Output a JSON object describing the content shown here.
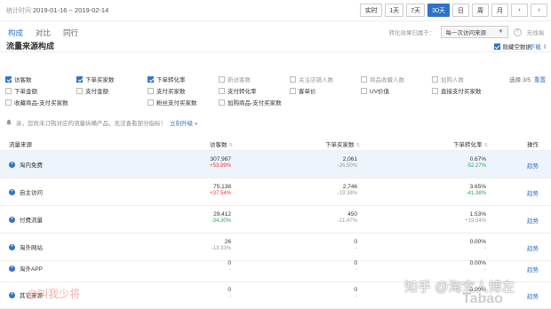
{
  "topbar": {
    "stat_label": "统计时间",
    "date_range": "2019-01-16 ~ 2019-02-14",
    "periods": [
      "实时",
      "1天",
      "7天",
      "30天",
      "日",
      "周",
      "月"
    ],
    "active_period": "30天"
  },
  "tabs": [
    {
      "label": "构成",
      "active": true
    },
    {
      "label": "对比",
      "active": false
    },
    {
      "label": "同行",
      "active": false
    }
  ],
  "attribution": {
    "label": "转化效果归属于：",
    "selected": "每一次访问来源",
    "no_empty_label": "无线端"
  },
  "section": {
    "title": "流量来源构成",
    "hide_empty_label": "隐藏空数据",
    "download_label": "下载"
  },
  "metrics": [
    {
      "label": "访客数",
      "checked": true
    },
    {
      "label": "下单买家数",
      "checked": true
    },
    {
      "label": "下单转化率",
      "checked": true
    },
    {
      "label": "新访客数",
      "checked": false
    },
    {
      "label": "关注店铺人数",
      "checked": false
    },
    {
      "label": "商品收藏人数",
      "checked": false
    },
    {
      "label": "加购人数",
      "checked": false
    },
    {
      "label": "下单金额",
      "checked": false
    },
    {
      "label": "支付金额",
      "checked": false
    },
    {
      "label": "支付买家数",
      "checked": false
    },
    {
      "label": "支付转化率",
      "checked": false
    },
    {
      "label": "客单价",
      "checked": false
    },
    {
      "label": "UV价值",
      "checked": false
    },
    {
      "label": "直接支付买家数",
      "checked": false
    },
    {
      "label": "收藏商品-支付买家数",
      "checked": false
    },
    {
      "label": "粉丝支付买家数",
      "checked": false
    },
    {
      "label": "加购商品-支付买家数",
      "checked": false
    }
  ],
  "select_count": {
    "text": "选择 3/5",
    "reset": "重置"
  },
  "notice": {
    "text": "亲，您尚未订购对应的流量纵横产品，无法查看部分指标！",
    "upgrade": "立刻升级 »"
  },
  "table": {
    "headers": {
      "source": "流量来源",
      "visitors": "访客数",
      "buyers": "下单买家数",
      "rate": "下单转化率",
      "ops": "操作"
    },
    "trend_label": "趋势",
    "rows": [
      {
        "name": "淘内免费",
        "visitors": "307,987",
        "visitors_delta": "+53.99%",
        "visitors_dir": "up",
        "buyers": "2,061",
        "buyers_delta": "-26.50%",
        "buyers_dir": "down",
        "rate": "0.67%",
        "rate_delta": "-52.27%",
        "rate_dir": "down",
        "highlight": true
      },
      {
        "name": "自主访问",
        "visitors": "75,138",
        "visitors_delta": "+37.54%",
        "visitors_dir": "up",
        "buyers": "2,746",
        "buyers_delta": "-19.38%",
        "buyers_dir": "down",
        "rate": "3.65%",
        "rate_delta": "-41.38%",
        "rate_dir": "down",
        "highlight": false
      },
      {
        "name": "付费流量",
        "visitors": "29,412",
        "visitors_delta": "-34.30%",
        "visitors_dir": "down",
        "buyers": "450",
        "buyers_delta": "-21.47%",
        "buyers_dir": "down",
        "rate": "1.53%",
        "rate_delta": "+19.54%",
        "rate_dir": "up",
        "highlight": false
      },
      {
        "name": "淘外网站",
        "visitors": "26",
        "visitors_delta": "-13.33%",
        "visitors_dir": "down",
        "buyers": "0",
        "buyers_delta": "-",
        "buyers_dir": "neutral",
        "rate": "0.00%",
        "rate_delta": "-",
        "rate_dir": "neutral",
        "highlight": false
      },
      {
        "name": "淘外APP",
        "visitors": "0",
        "visitors_delta": "-",
        "visitors_dir": "neutral",
        "buyers": "0",
        "buyers_delta": "-",
        "buyers_dir": "neutral",
        "rate": "0.00%",
        "rate_delta": "-",
        "rate_dir": "neutral",
        "highlight": false
      },
      {
        "name": "其它来源",
        "visitors": "0",
        "visitors_delta": "-",
        "visitors_dir": "neutral",
        "buyers": "0",
        "buyers_delta": "-",
        "buyers_dir": "neutral",
        "rate": "0.00%",
        "rate_delta": "-",
        "rate_dir": "neutral",
        "highlight": false
      }
    ]
  },
  "watermarks": {
    "left": "@叫我少将",
    "right": "知乎 @淘宝人博左",
    "corner": "Tabao"
  },
  "colors": {
    "accent": "#2f73c9",
    "up": "#e4393c",
    "down": "#26a65b",
    "row_highlight": "#eef4fc"
  }
}
